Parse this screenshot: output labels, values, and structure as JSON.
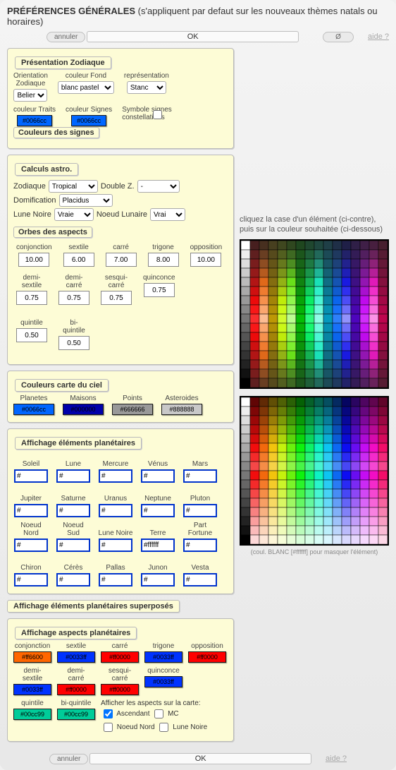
{
  "header": {
    "title": "PRÉFÉRENCES GÉNÉRALES",
    "subtitle": "(s'appliquent par defaut sur les nouveaux thèmes natals ou horaires)"
  },
  "toolbar": {
    "cancel": "annuler",
    "ok": "OK",
    "reset": "Ø",
    "help": "aide ?"
  },
  "zodiac": {
    "legend": "Présentation Zodiaque",
    "orientation_label": "Orientation\nZodiaque",
    "orientation_value": "Belier",
    "bgcolor_label": "couleur Fond",
    "bgcolor_value": "blanc pastel",
    "repr_label": "représentation",
    "repr_value": "Stanc",
    "traits_label": "couleur Traits",
    "traits_value": "#0066cc",
    "signes_label": "couleur Signes",
    "signes_value": "#0066cc",
    "symbol_label": "Symbole signes constellations",
    "colors_signs": "Couleurs des signes"
  },
  "calc": {
    "legend": "Calculs astro.",
    "zodiac_label": "Zodiaque",
    "zodiac_value": "Tropical",
    "doublez_label": "Double Z.",
    "doublez_value": "-",
    "domif_label": "Domification",
    "domif_value": "Placidus",
    "lune_label": "Lune Noire",
    "lune_value": "Vraie",
    "noeud_label": "Noeud Lunaire",
    "noeud_value": "Vrai",
    "orbes_legend": "Orbes des aspects",
    "orbes": [
      {
        "label": "conjonction",
        "val": "10.00"
      },
      {
        "label": "sextile",
        "val": "6.00"
      },
      {
        "label": "carré",
        "val": "7.00"
      },
      {
        "label": "trigone",
        "val": "8.00"
      },
      {
        "label": "opposition",
        "val": "10.00"
      },
      {
        "label": "demi-\nsextile",
        "val": "0.75"
      },
      {
        "label": "demi-\ncarré",
        "val": "0.75"
      },
      {
        "label": "sesqui-\ncarré",
        "val": "0.75"
      },
      {
        "label": "quinconce",
        "val": "0.75"
      },
      {
        "label": "quintile",
        "val": "0.50"
      },
      {
        "label": "bi-\nquintile",
        "val": "0.50"
      }
    ]
  },
  "sky": {
    "legend": "Couleurs carte du ciel",
    "items": [
      {
        "label": "Planetes",
        "val": "#0066cc",
        "bg": "#0066ff"
      },
      {
        "label": "Maisons",
        "val": "#000000",
        "bg": "#0000aa"
      },
      {
        "label": "Points",
        "val": "#666666",
        "bg": "#999999"
      },
      {
        "label": "Asteroides",
        "val": "#888888",
        "bg": "#c8c8c8"
      }
    ]
  },
  "planets": {
    "legend": "Affichage éléments planétaires",
    "items": [
      {
        "label": "Soleil",
        "val": "#"
      },
      {
        "label": "Lune",
        "val": "#"
      },
      {
        "label": "Mercure",
        "val": "#"
      },
      {
        "label": "Vénus",
        "val": "#"
      },
      {
        "label": "Mars",
        "val": "#"
      },
      {
        "label": "Jupiter",
        "val": "#"
      },
      {
        "label": "Saturne",
        "val": "#"
      },
      {
        "label": "Uranus",
        "val": "#"
      },
      {
        "label": "Neptune",
        "val": "#"
      },
      {
        "label": "Pluton",
        "val": "#"
      },
      {
        "label": "Noeud Nord",
        "val": "#"
      },
      {
        "label": "Noeud Sud",
        "val": "#"
      },
      {
        "label": "Lune Noire",
        "val": "#"
      },
      {
        "label": "Terre",
        "val": "#ffffff"
      },
      {
        "label": "Part Fortune",
        "val": "#"
      },
      {
        "label": "Chiron",
        "val": "#"
      },
      {
        "label": "Cérès",
        "val": "#"
      },
      {
        "label": "Pallas",
        "val": "#"
      },
      {
        "label": "Junon",
        "val": "#"
      },
      {
        "label": "Vesta",
        "val": "#"
      }
    ]
  },
  "overlay": {
    "legend": "Affichage éléments planétaires superposés"
  },
  "aspects": {
    "legend": "Affichage aspects planétaires",
    "row1": [
      {
        "label": "conjonction",
        "val": "#ff6600",
        "bg": "#ff6600"
      },
      {
        "label": "sextile",
        "val": "#0033ff",
        "bg": "#0033ff"
      },
      {
        "label": "carré",
        "val": "#ff0000",
        "bg": "#ff0000"
      },
      {
        "label": "trigone",
        "val": "#0033ff",
        "bg": "#0033ff"
      },
      {
        "label": "opposition",
        "val": "#ff0000",
        "bg": "#ff0000"
      }
    ],
    "row2": [
      {
        "label": "demi-\nsextile",
        "val": "#0033ff",
        "bg": "#0033ff"
      },
      {
        "label": "demi-\ncarré",
        "val": "#ff0000",
        "bg": "#ff0000"
      },
      {
        "label": "sesqui-\ncarré",
        "val": "#ff0000",
        "bg": "#ff0000"
      },
      {
        "label": "quinconce",
        "val": "#0033ff",
        "bg": "#0033ff"
      }
    ],
    "row3": [
      {
        "label": "quintile",
        "val": "#00cc99",
        "bg": "#00cc99"
      },
      {
        "label": "bi-quintile",
        "val": "#00cc99",
        "bg": "#00cc99"
      }
    ],
    "show_label": "Afficher les aspects sur la carte:",
    "cb": [
      {
        "label": "Ascendant",
        "checked": true
      },
      {
        "label": "MC",
        "checked": false
      },
      {
        "label": "Noeud Nord",
        "checked": false
      },
      {
        "label": "Lune Noire",
        "checked": false
      }
    ]
  },
  "picker": {
    "hint": "cliquez la case d'un élément (ci-contre), puis sur la couleur souhaitée (ci-dessous)",
    "note": "(coul. BLANC [#ffffff] pour masquer l'élément)"
  }
}
